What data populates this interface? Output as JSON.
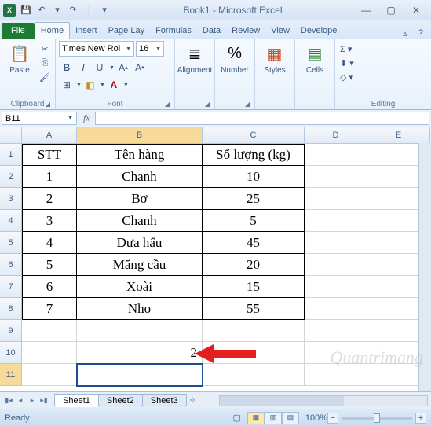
{
  "window": {
    "title": "Book1 - Microsoft Excel"
  },
  "qat": {
    "save": "💾",
    "undo": "↶",
    "redo": "↷"
  },
  "tabs": {
    "file": "File",
    "items": [
      "Home",
      "Insert",
      "Page Lay",
      "Formulas",
      "Data",
      "Review",
      "View",
      "Develope"
    ],
    "active": 0
  },
  "ribbon": {
    "clipboard": {
      "label": "Clipboard",
      "paste": "Paste"
    },
    "font": {
      "label": "Font",
      "name": "Times New Roi",
      "size": "16",
      "bold": "B",
      "italic": "I",
      "underline": "U"
    },
    "alignment": {
      "label": "Alignment"
    },
    "number": {
      "label": "Number"
    },
    "styles": {
      "label": "Styles"
    },
    "cells": {
      "label": "Cells"
    },
    "editing": {
      "label": "Editing"
    }
  },
  "namebox": "B11",
  "formula": "",
  "columns": [
    "A",
    "B",
    "C",
    "D",
    "E"
  ],
  "row_count": 11,
  "active_cell": "B11",
  "table": {
    "header": {
      "A": "STT",
      "B": "Tên hàng",
      "C": "Số lượng (kg)"
    },
    "rows": [
      {
        "A": "1",
        "B": "Chanh",
        "C": "10"
      },
      {
        "A": "2",
        "B": "Bơ",
        "C": "25"
      },
      {
        "A": "3",
        "B": "Chanh",
        "C": "5"
      },
      {
        "A": "4",
        "B": "Dưa hấu",
        "C": "45"
      },
      {
        "A": "5",
        "B": "Măng cầu",
        "C": "20"
      },
      {
        "A": "6",
        "B": "Xoài",
        "C": "15"
      },
      {
        "A": "7",
        "B": "Nho",
        "C": "55"
      }
    ]
  },
  "extra": {
    "b10": "2"
  },
  "sheets": {
    "items": [
      "Sheet1",
      "Sheet2",
      "Sheet3"
    ],
    "active": 0
  },
  "status": {
    "text": "Ready",
    "zoom": "100%"
  },
  "watermark": "Quantrimang"
}
